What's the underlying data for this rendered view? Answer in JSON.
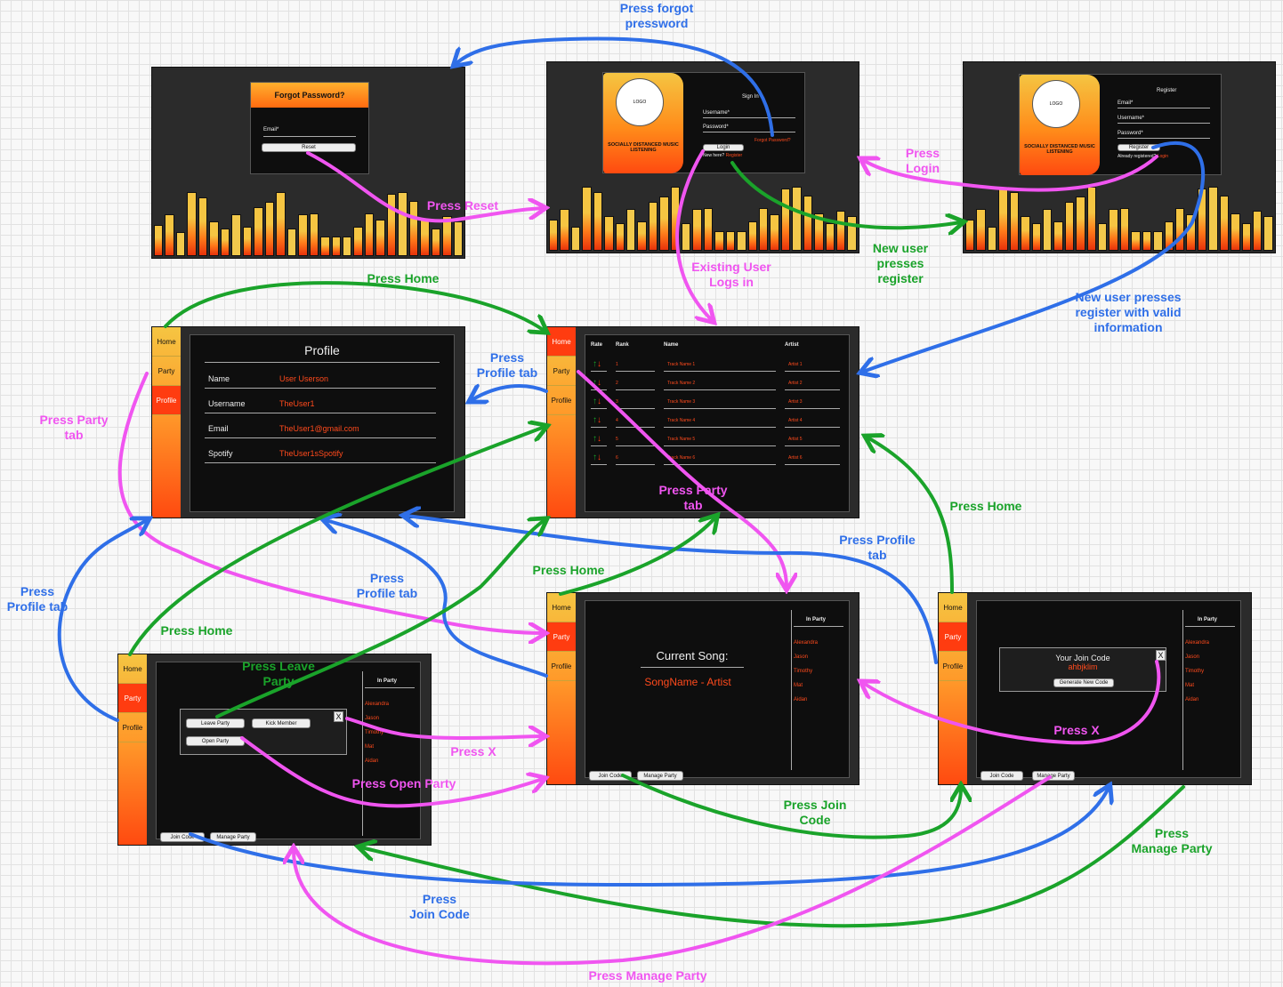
{
  "forgot": {
    "title": "Forgot Password?",
    "email": "Email*",
    "reset": "Reset"
  },
  "login": {
    "logo": "LOGO",
    "tagline": "SOCIALLY DISTANCED MUSIC LISTENING",
    "signin": "Sign In",
    "username": "Username*",
    "password": "Password*",
    "login_btn": "Login",
    "forgot_link": "Forgot Password?",
    "new_here": "New here?",
    "register_link": "Register"
  },
  "register": {
    "logo": "LOGO",
    "tagline": "SOCIALLY DISTANCED MUSIC LISTENING",
    "heading": "Register",
    "email": "Email*",
    "username": "Username*",
    "password": "Password*",
    "register_btn": "Register",
    "already": "Already registered?",
    "login_link": "Login"
  },
  "tabs": {
    "home": "Home",
    "party": "Party",
    "profile": "Profile"
  },
  "profile": {
    "title": "Profile",
    "rows": [
      [
        "Name",
        "User Userson"
      ],
      [
        "Username",
        "TheUser1"
      ],
      [
        "Email",
        "TheUser1@gmail.com"
      ],
      [
        "Spotify",
        "TheUser1sSpotify"
      ]
    ]
  },
  "home": {
    "headers": [
      "Rate",
      "Rank",
      "Name",
      "Artist"
    ],
    "rows": [
      [
        "1",
        "Track Name 1",
        "Artist 1"
      ],
      [
        "2",
        "Track Name 2",
        "Artist 2"
      ],
      [
        "3",
        "Track Name 3",
        "Artist 3"
      ],
      [
        "4",
        "Track Name 4",
        "Artist 4"
      ],
      [
        "5",
        "Track Name 5",
        "Artist 5"
      ],
      [
        "6",
        "Track Name 6",
        "Artist 6"
      ]
    ]
  },
  "party": {
    "current_song": "Current Song:",
    "song": "SongName - Artist",
    "in_party": "In Party",
    "members": [
      "Alexandra",
      "Jason",
      "Timothy",
      "Mat",
      "Aidan"
    ],
    "join_code": "Join Code",
    "manage_party": "Manage Party"
  },
  "join": {
    "your_code": "Your Join Code",
    "code": "ahbjklim",
    "generate": "Generate New Code",
    "close": "X"
  },
  "manage": {
    "leave": "Leave Party",
    "kick": "Kick Member",
    "open": "Open Party",
    "close": "X"
  },
  "labels": {
    "press_forgot": "Press forgot\npressword",
    "press_reset": "Press Reset",
    "press_login": "Press\nLogin",
    "new_user_register": "New user\npresses\nregister",
    "existing_user": "Existing User\nLogs in",
    "new_user_valid": "New user presses\nregister with valid\ninformation",
    "press_home_top": "Press Home",
    "press_profile_tab": "Press\nProfile tab",
    "press_party_tab_left": "Press Party\ntab",
    "press_party_tab_mid": "Press Party\ntab",
    "press_home_right": "Press Home",
    "press_profile_tab_right": "Press Profile\ntab",
    "press_profile_tab_left": "Press\nProfile tab",
    "press_profile_tab_mid": "Press\nProfile tab",
    "press_home_left": "Press Home",
    "press_leave": "Press Leave\nParty",
    "press_home_mid": "Press Home",
    "press_x_left": "Press X",
    "press_open": "Press Open Party",
    "press_x_right": "Press X",
    "press_join_code_right": "Press Join\nCode",
    "press_manage_right": "Press\nManage Party",
    "press_join_code_bottom": "Press\nJoin Code",
    "press_manage_bottom": "Press Manage Party"
  },
  "colors": {
    "pink": "#f055f0",
    "green": "#1aa32a",
    "blue": "#2f6fe8",
    "orange": "#ff4a1c"
  }
}
